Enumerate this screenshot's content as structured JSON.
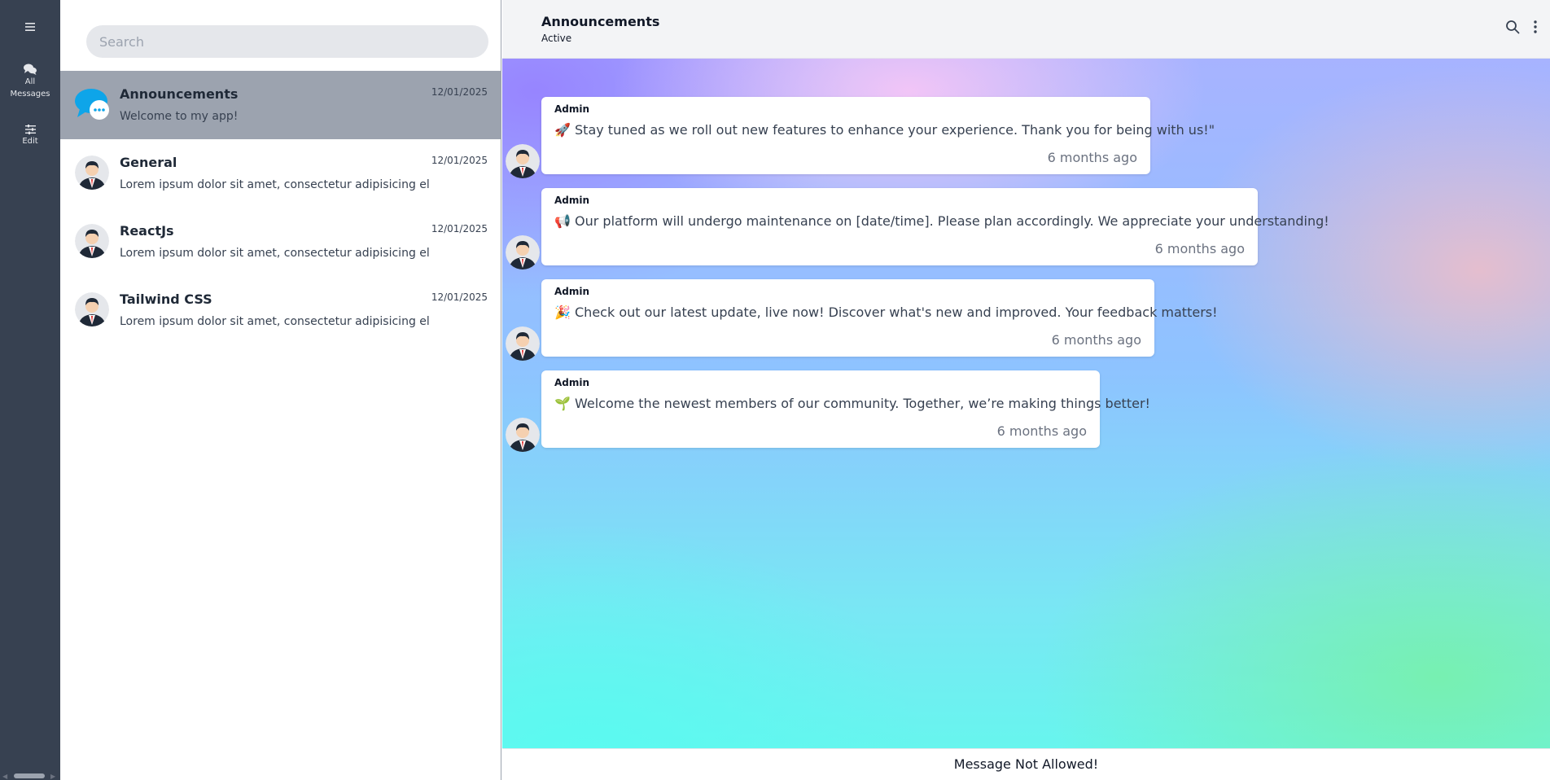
{
  "rail": {
    "menu_icon": "hamburger-icon",
    "all_messages_label": "All Messages",
    "edit_label": "Edit"
  },
  "search": {
    "placeholder": "Search"
  },
  "chats": [
    {
      "name": "Announcements",
      "date": "12/01/2025",
      "preview": "Welcome to my app!",
      "active": true,
      "avatar": "chat-bubble-icon"
    },
    {
      "name": "General",
      "date": "12/01/2025",
      "preview": "Lorem ipsum dolor sit amet, consectetur adipisicing elit. Perferendis",
      "avatar": "user-avatar"
    },
    {
      "name": "ReactJs",
      "date": "12/01/2025",
      "preview": "Lorem ipsum dolor sit amet, consectetur adipisicing elit. Perferendis",
      "avatar": "user-avatar"
    },
    {
      "name": "Tailwind CSS",
      "date": "12/01/2025",
      "preview": "Lorem ipsum dolor sit amet, consectetur adipisicing elit. Perferendis",
      "avatar": "user-avatar"
    }
  ],
  "header": {
    "title": "Announcements",
    "status": "Active"
  },
  "messages": [
    {
      "sender": "Admin",
      "text": "🚀 Stay tuned as we roll out new features to enhance your experience. Thank you for being with us!\"",
      "time": "6 months ago"
    },
    {
      "sender": "Admin",
      "text": "📢 Our platform will undergo maintenance on [date/time]. Please plan accordingly. We appreciate your understanding!",
      "time": "6 months ago"
    },
    {
      "sender": "Admin",
      "text": "🎉 Check out our latest update, live now! Discover what's new and improved. Your feedback matters!",
      "time": "6 months ago"
    },
    {
      "sender": "Admin",
      "text": "🌱 Welcome the newest members of our community. Together, we’re making things better!",
      "time": "6 months ago"
    }
  ],
  "footer": {
    "notice": "Message Not Allowed!"
  },
  "colors": {
    "rail": "#374151",
    "active_chat": "#9ca3af",
    "bubble_icon": "#0ea5e9"
  }
}
